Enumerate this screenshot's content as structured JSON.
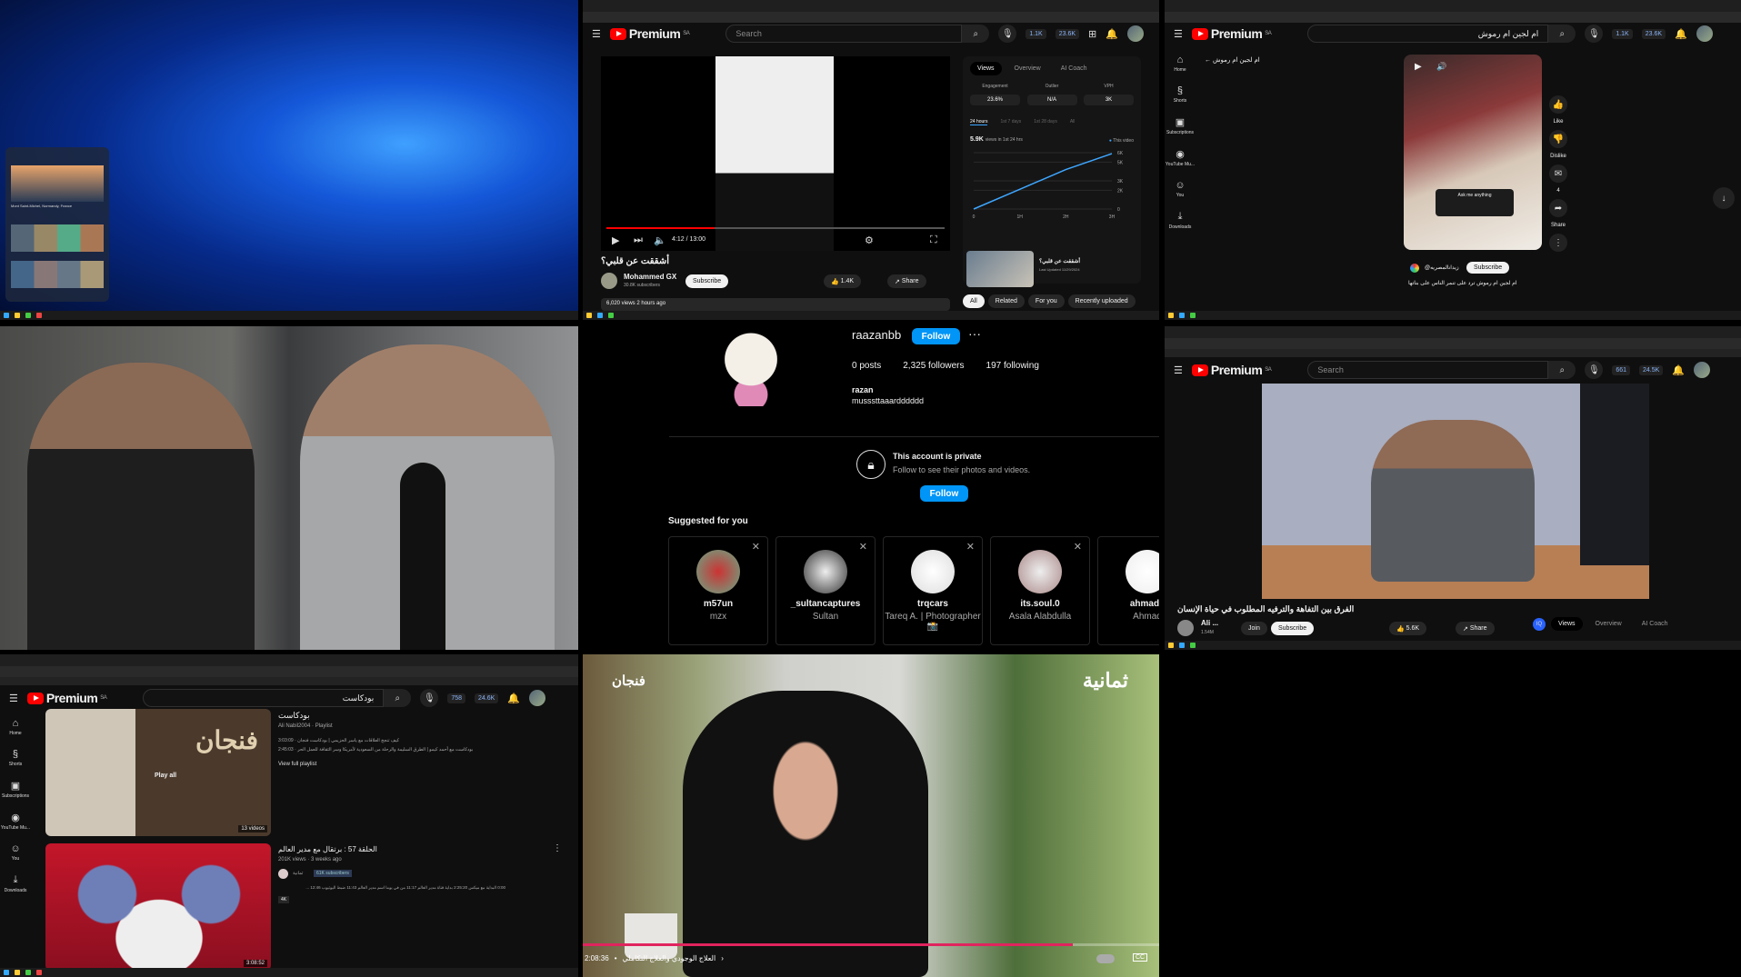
{
  "desktop": {
    "widget_caption": "Mont Saint-Michel, Normandy, France",
    "colors": {
      "wallpaper": "#0a3ea8"
    }
  },
  "yt_common": {
    "brand": "Premium",
    "region": "SA",
    "search_placeholder": "Search"
  },
  "panel_top_middle": {
    "stats": [
      "1.1K",
      "23.6K"
    ],
    "time": "4:12 / 13:00",
    "progress": 0.32,
    "video_title": "أشققت عن قلبي؟",
    "channel": "Mohammed GX",
    "subscribers": "30.8K subscribers",
    "subscribe": "Subscribe",
    "likes": "1.4K",
    "share": "Share",
    "views_line": "6,020 views  2 hours ago",
    "analytics": {
      "tabs": [
        "Views",
        "Overview",
        "AI Coach"
      ],
      "metrics": [
        {
          "label": "Engagement",
          "value": "23.6%"
        },
        {
          "label": "Outlier",
          "value": "N/A"
        },
        {
          "label": "VPH",
          "value": "3K"
        }
      ],
      "ranges": [
        "24 hours",
        "1st 7 days",
        "1st 28 days",
        "All"
      ],
      "headline": "5.9K",
      "headline_sub": "views in 1st 24 hrs",
      "legend": "This video",
      "chart_data": {
        "type": "line",
        "x": [
          "0",
          "1H",
          "2H",
          "3H"
        ],
        "y_ticks": [
          "0",
          "2K",
          "3K",
          "5K",
          "6K"
        ],
        "series": [
          {
            "name": "This video",
            "values": [
              0,
              2100,
              4200,
              5900
            ]
          }
        ]
      },
      "video_card_title": "أشققت عن قلبي؟",
      "video_card_sub": "Last Updated 11/29/2024"
    },
    "chips": [
      "All",
      "Related",
      "For you",
      "Recently uploaded"
    ]
  },
  "panel_top_right": {
    "search_value": "ام لجين ام رموش",
    "stats": [
      "1.1K",
      "23.6K"
    ],
    "sidebar": [
      "Home",
      "Shorts",
      "Subscriptions",
      "YouTube Mu...",
      "You",
      "Downloads"
    ],
    "back_label": "ام لجين ام رموش",
    "actions": {
      "like": "Like",
      "dislike": "Dislike",
      "comments": "4",
      "share": "Share"
    },
    "short_overlay": "Ask me anything",
    "channel": "@زيدانالمصريه",
    "subscribe": "Subscribe",
    "short_title": "ام لجين ام رموش ترد على تنمر الناس على بناتها"
  },
  "panel_instagram": {
    "username": "raazanbb",
    "follow": "Follow",
    "posts": "0 posts",
    "followers": "2,325 followers",
    "following": "197 following",
    "name": "razan",
    "bio": "musssttaaardddddd",
    "private_title": "This account is private",
    "private_sub": "Follow to see their photos and videos.",
    "suggested_title": "Suggested for you",
    "suggested": [
      {
        "user": "m57un",
        "name": "mzx"
      },
      {
        "user": "_sultancaptures",
        "name": "Sultan"
      },
      {
        "user": "trqcars",
        "name": "Tareq A. | Photographer 📸"
      },
      {
        "user": "its.soul.0",
        "name": "Asala Alabdulla"
      },
      {
        "user": "ahmadg",
        "name": "Ahmad"
      }
    ]
  },
  "panel_mid_right": {
    "stats": [
      "661",
      "24.5K"
    ],
    "video_title": "الفرق بين التفاهة والترفيه المطلوب في حياة الإنسان",
    "channel": "Ali ...",
    "subscribers": "1.54M",
    "join": "Join",
    "subscribe": "Subscribe",
    "likes": "5.6K",
    "share": "Share",
    "tabs": [
      "Views",
      "Overview",
      "AI Coach"
    ]
  },
  "panel_bottom_left": {
    "search_value": "بودكاست",
    "stats": [
      "758",
      "24.6K"
    ],
    "sidebar": [
      "Home",
      "Shorts",
      "Subscriptions",
      "YouTube Mu...",
      "You",
      "Downloads"
    ],
    "playlist": {
      "title": "بودكاست",
      "meta": "Ali Nabil2004 · Playlist",
      "items": [
        "كيف تنجح العلاقات مع ياسر الحزيمي | بودكاست فنجان · 3:03:09",
        "بودكاست مع أحمد كيمو | الطرق السليمة والرحلة من السعودية لأمريكا وسر الثقافة للعمل الحر · 2:45:03"
      ],
      "view_full": "View full playlist",
      "play_all": "Play all",
      "count": "13 videos",
      "thumb_text": "فنجان"
    },
    "video": {
      "title": "الحلقة 57 : برتقال مع مدير العالم",
      "meta": "201K views · 3 weeks ago",
      "channel": "ثمانية",
      "subs": "61K subscribers",
      "desc": "0:00 البداية مع ميكس 2:25:20 بداية قناة مدير العالم 11:17 من في يوما اسم مدير العالم 11:43 ضبط اليوتيوب 12:46 ...",
      "badge": "4K",
      "duration": "3:08:52"
    }
  },
  "panel_bottom_middle": {
    "brand_left": "فنجان",
    "brand_right": "ثمانية",
    "time": "2:08:36",
    "chapter": "العلاج الوجودي والعلاج التكاملي",
    "progress": 0.85,
    "cc": "CC"
  }
}
